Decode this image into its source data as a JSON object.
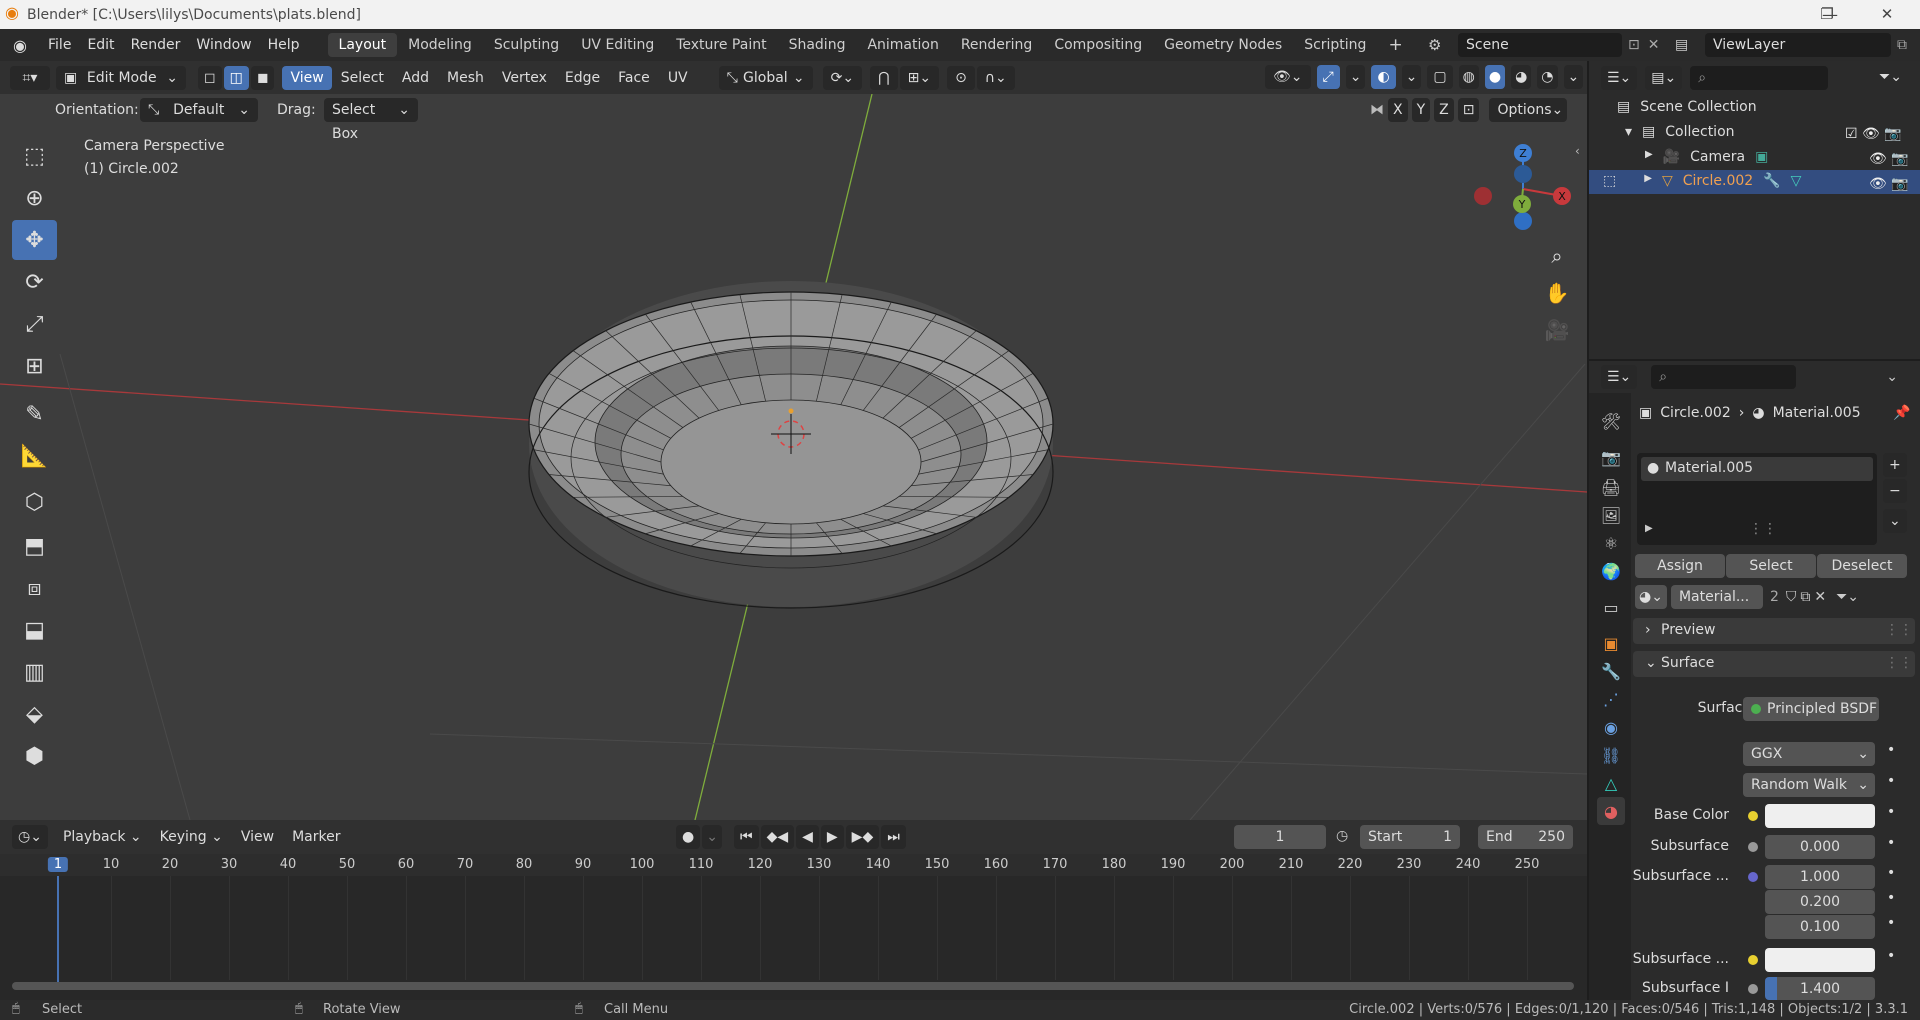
{
  "window": {
    "title": "Blender* [C:\\Users\\lilys\\Documents\\plats.blend]",
    "controls": [
      "—",
      "❐",
      "✕"
    ]
  },
  "menus": [
    "File",
    "Edit",
    "Render",
    "Window",
    "Help"
  ],
  "workspaces": [
    "Layout",
    "Modeling",
    "Sculpting",
    "UV Editing",
    "Texture Paint",
    "Shading",
    "Animation",
    "Rendering",
    "Compositing",
    "Geometry Nodes",
    "Scripting"
  ],
  "scene": {
    "name": "Scene",
    "view_layer": "ViewLayer"
  },
  "header": {
    "mode": "Edit Mode",
    "menus": [
      "View",
      "Select",
      "Add",
      "Mesh",
      "Vertex",
      "Edge",
      "Face",
      "UV"
    ],
    "transform": "Global",
    "orientation_label": "Orientation:",
    "orientation_value": "Default",
    "drag_label": "Drag:",
    "drag_value": "Select Box",
    "axes": [
      "X",
      "Y",
      "Z"
    ],
    "options": "Options"
  },
  "viewport": {
    "perspective": "Camera Perspective",
    "object": "(1) Circle.002"
  },
  "gizmo": {
    "x": "X",
    "y": "Y",
    "z": "Z"
  },
  "timeline": {
    "menus": [
      "Playback",
      "Keying",
      "View",
      "Marker"
    ],
    "current_frame": "1",
    "start_label": "Start",
    "start": "1",
    "end_label": "End",
    "end": "250",
    "ruler": [
      "1",
      "10",
      "20",
      "30",
      "40",
      "50",
      "60",
      "70",
      "80",
      "90",
      "100",
      "110",
      "120",
      "130",
      "140",
      "150",
      "160",
      "170",
      "180",
      "190",
      "200",
      "210",
      "220",
      "230",
      "240",
      "250"
    ]
  },
  "status": {
    "select": "Select",
    "rotate": "Rotate View",
    "call_menu": "Call Menu",
    "stats": "Circle.002 | Verts:0/576 | Edges:0/1,120 | Faces:0/546 | Tris:1,148 | Objects:1/2 | 3.3.1"
  },
  "outliner": {
    "root": "Scene Collection",
    "collection": "Collection",
    "items": [
      "Camera",
      "Circle.002"
    ]
  },
  "properties": {
    "breadcrumb_object": "Circle.002",
    "breadcrumb_material": "Material.005",
    "slot": "Material.005",
    "assign": "Assign",
    "select": "Select",
    "deselect": "Deselect",
    "material_short": "Material...",
    "users": "2",
    "preview": "Preview",
    "surface_panel": "Surface",
    "surface_label": "Surface",
    "surface_value": "Principled BSDF",
    "distribution": "GGX",
    "subsurface_method": "Random Walk",
    "base_color_label": "Base Color",
    "subsurface_label": "Subsurface",
    "subsurface_value": "0.000",
    "subsurface_radius_label": "Subsurface ...",
    "radius": [
      "1.000",
      "0.200",
      "0.100"
    ],
    "subsurface_color_label": "Subsurface ...",
    "subsurface_ior_label": "Subsurface I",
    "subsurface_ior": "1.400"
  },
  "colors": {
    "accent": "#4772b3",
    "x_axis": "#c8393c",
    "y_axis": "#7fad3c",
    "z_axis": "#3e7fd4",
    "bg": "#3d3d3d"
  }
}
